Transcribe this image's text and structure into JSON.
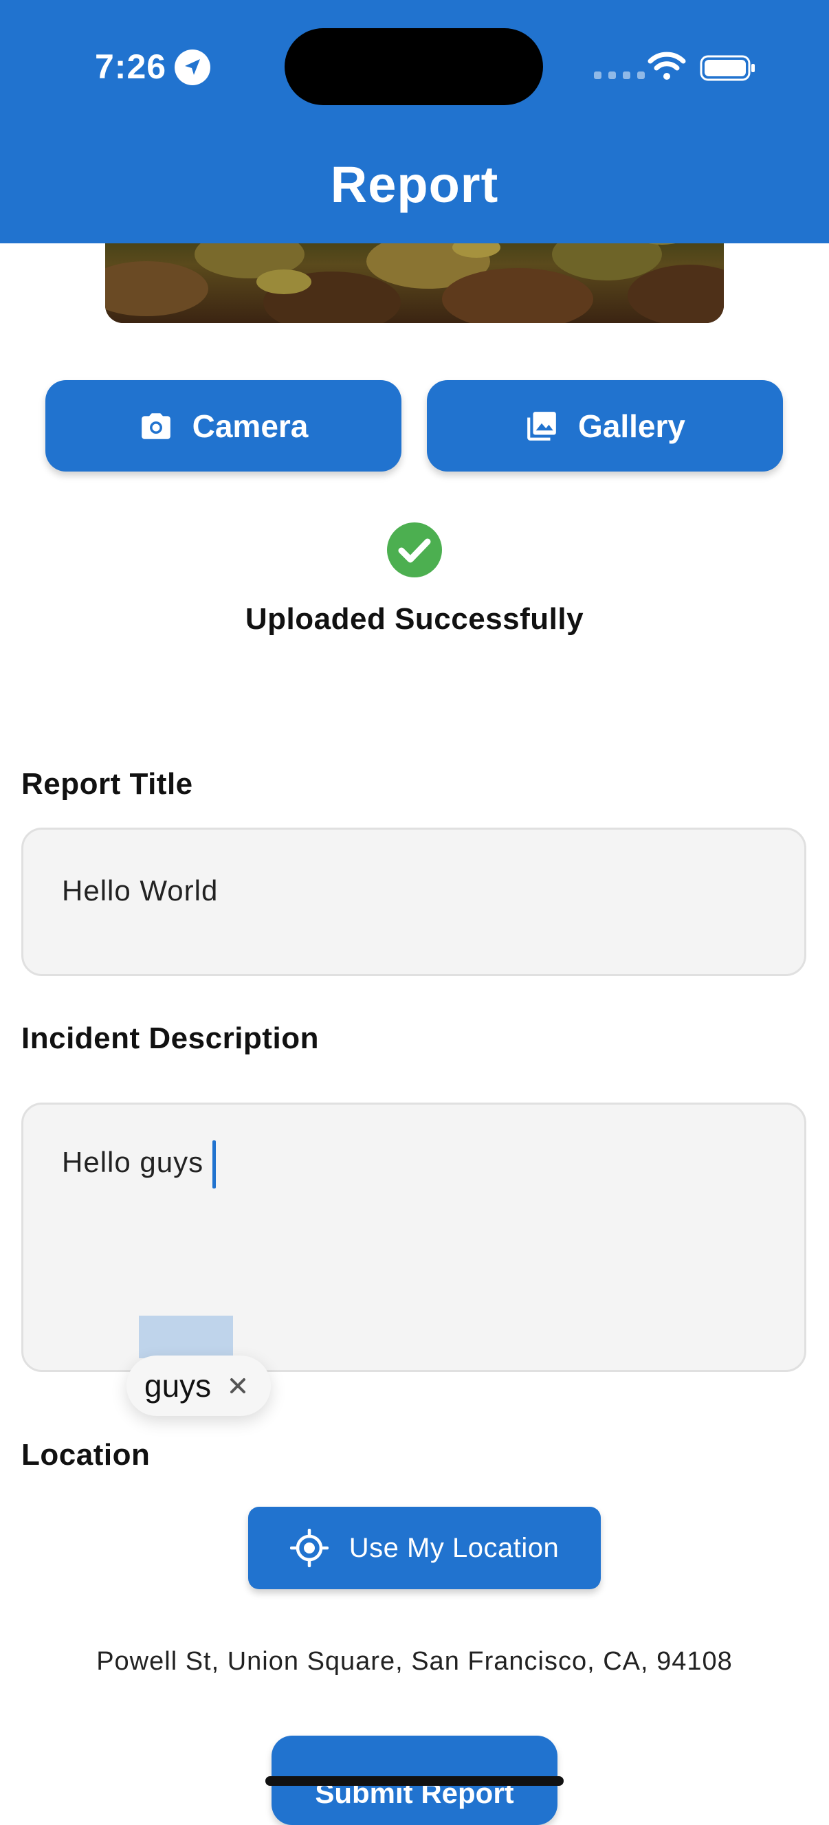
{
  "status_bar": {
    "time": "7:26",
    "icons": [
      "location-arrow-icon",
      "signal-icon",
      "wifi-icon",
      "battery-icon"
    ]
  },
  "header": {
    "title": "Report",
    "background": "#2173CF"
  },
  "photo": {
    "icon": "uploaded-photo"
  },
  "buttons": {
    "camera_label": "Camera",
    "camera_icon": "camera-icon",
    "gallery_label": "Gallery",
    "gallery_icon": "image-icon",
    "location_label": "Use My Location",
    "location_icon": "crosshair-icon",
    "submit_label": "Submit Report"
  },
  "upload": {
    "status_text": "Uploaded Successfully",
    "status_icon": "check-circle-icon",
    "status_color": "#4CAF50"
  },
  "form": {
    "title_label": "Report Title",
    "title_value": "Hello World",
    "description_label": "Incident Description",
    "description_value": "Hello guys",
    "location_label": "Location",
    "address": "Powell St, Union Square, San Francisco, CA, 94108"
  },
  "text_suggestion": {
    "word": "guys",
    "dismiss_icon": "close-icon"
  },
  "colors": {
    "accent": "#2173CF",
    "field_background": "#F4F4F4",
    "field_border": "#E0E0E0"
  }
}
